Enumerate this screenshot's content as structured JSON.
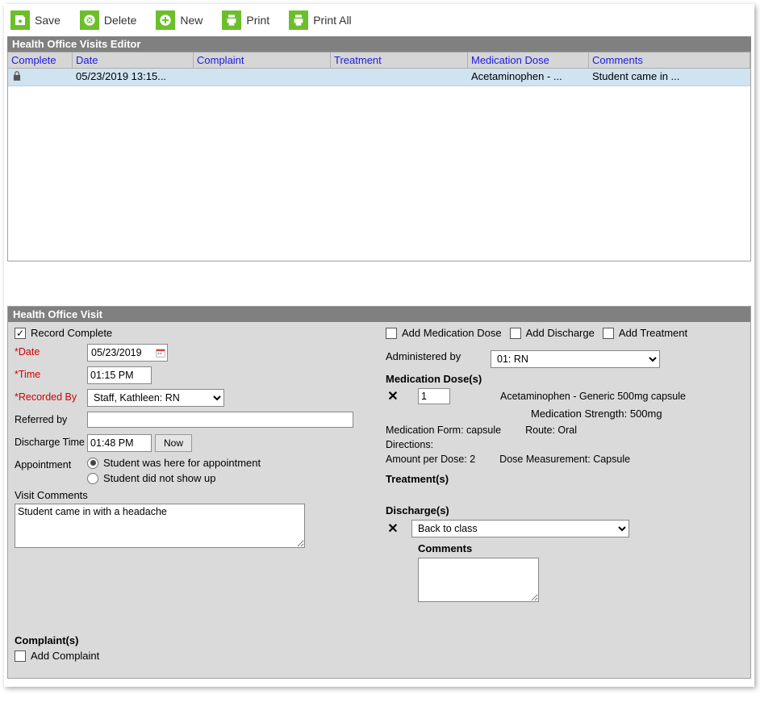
{
  "toolbar": {
    "save": "Save",
    "delete": "Delete",
    "new": "New",
    "print": "Print",
    "printAll": "Print All"
  },
  "editor": {
    "title": "Health Office Visits Editor",
    "headers": {
      "complete": "Complete",
      "date": "Date",
      "complaint": "Complaint",
      "treatment": "Treatment",
      "medication": "Medication Dose",
      "comments": "Comments"
    },
    "row": {
      "date": "05/23/2019 13:15...",
      "complaint": "",
      "treatment": "",
      "medication": "Acetaminophen - ...",
      "comments": "Student came in ..."
    }
  },
  "form": {
    "title": "Health Office Visit",
    "recordCompleteLabel": "Record Complete",
    "labels": {
      "date": "*Date",
      "time": "*Time",
      "recordedBy": "*Recorded By",
      "referredBy": "Referred by",
      "dischargeTime": "Discharge Time",
      "appointment": "Appointment",
      "visitComments": "Visit Comments",
      "complaints": "Complaint(s)",
      "addComplaint": "Add Complaint",
      "addMedDose": "Add Medication Dose",
      "addDischarge": "Add Discharge",
      "addTreatment": "Add Treatment",
      "administeredBy": "Administered by",
      "medDoses": "Medication Dose(s)",
      "treatments": "Treatment(s)",
      "discharges": "Discharge(s)",
      "comments": "Comments",
      "now": "Now"
    },
    "values": {
      "date": "05/23/2019",
      "time": "01:15 PM",
      "recordedBy": "Staff, Kathleen: RN",
      "referredBy": "",
      "dischargeTime": "01:48 PM",
      "appt1": "Student was here for appointment",
      "appt2": "Student did not show up",
      "visitComments": "Student came in with a headache",
      "administeredBy": "01: RN",
      "doseQty": "1",
      "medName": "Acetaminophen - Generic 500mg capsule",
      "medStrength": "Medication Strength: 500mg",
      "medForm": "Medication Form: capsule",
      "route": "Route: Oral",
      "directions": "Directions:",
      "amountPerDose": "Amount per Dose: 2",
      "doseMeasurement": "Dose Measurement: Capsule",
      "dischargeSelected": "Back to class",
      "dischargeComments": ""
    }
  }
}
